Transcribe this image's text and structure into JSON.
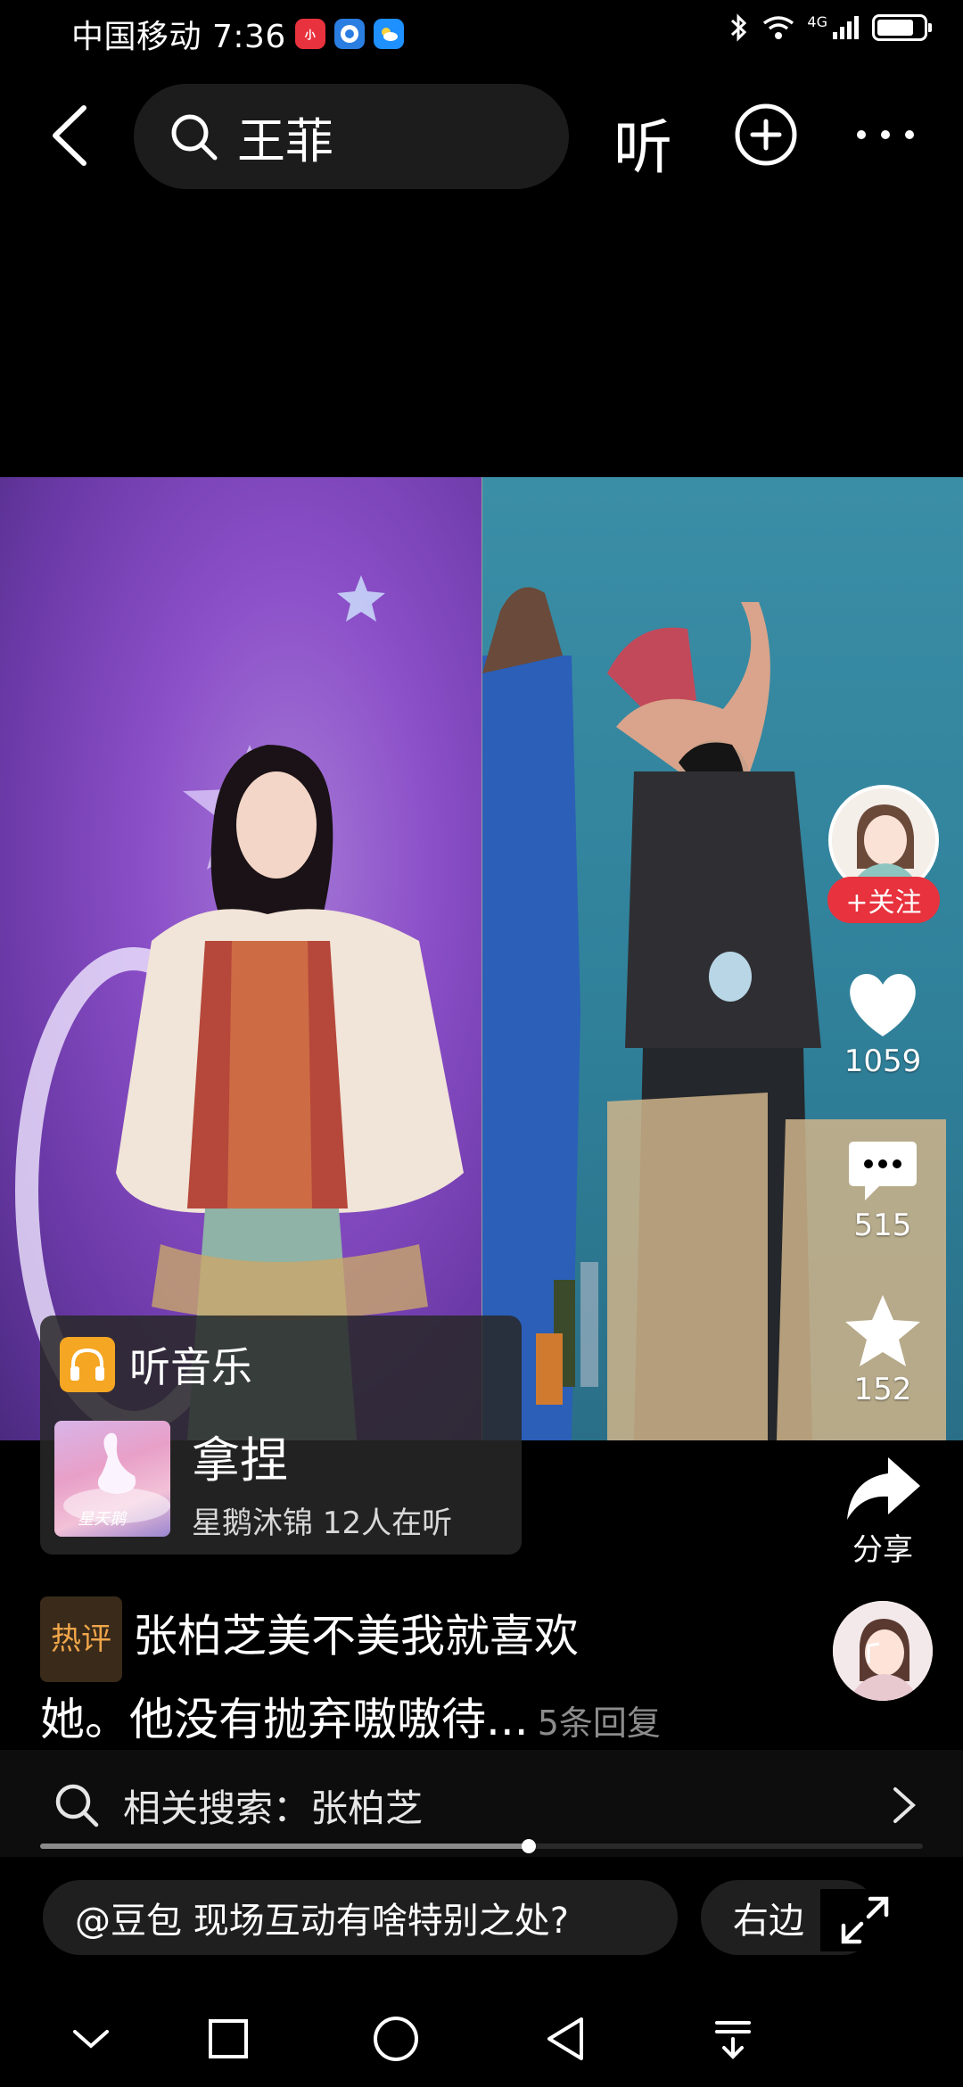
{
  "status_bar": {
    "carrier_time": "中国移动 7:36",
    "app_badge_1": "小红书",
    "network": "4G"
  },
  "search": {
    "query": "王菲",
    "listen_label": "听"
  },
  "video": {
    "panels": [
      "concert-performer",
      "person-dancing-in-room"
    ]
  },
  "author": {
    "follow_label": "+关注"
  },
  "actions": {
    "likes": "1059",
    "comments": "515",
    "favorites": "152",
    "share_label": "分享"
  },
  "music": {
    "header_label": "听音乐",
    "song_title": "拿捏",
    "song_meta": "星鹅沐锦 12人在听",
    "cover_text": "星天鹅"
  },
  "comment": {
    "tag": "热评",
    "line1": "张柏芝美不美我就喜欢",
    "line2": "她。他没有抛弃嗷嗷待...",
    "reply_count": "5条回复"
  },
  "related_search": {
    "text": "相关搜索：张柏芝",
    "progress_fraction": 0.554
  },
  "chips": [
    "@豆包 现场互动有啥特别之处?",
    "右边"
  ],
  "colors": {
    "follow_red": "#e8323d",
    "hot_tag_orange": "#f0a64a",
    "music_badge": "#f5a623"
  }
}
